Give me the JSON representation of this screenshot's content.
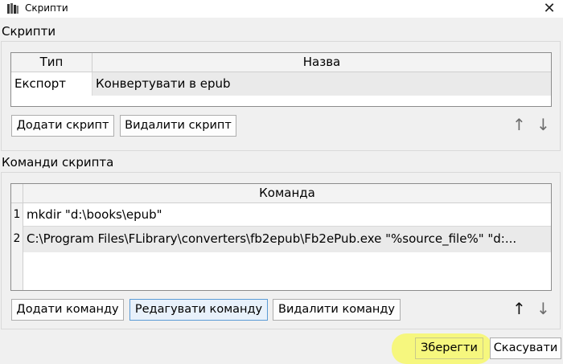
{
  "window": {
    "title": "Скрипти"
  },
  "scripts": {
    "section_label": "Скрипти",
    "columns": [
      "Тип",
      "Назва"
    ],
    "rows": [
      {
        "type": "Експорт",
        "name": "Конвертувати в epub"
      }
    ],
    "add_button": "Додати скрипт",
    "delete_button": "Видалити скрипт"
  },
  "commands": {
    "section_label": "Команди скрипта",
    "column": "Команда",
    "rows": [
      {
        "index": "1",
        "command": "mkdir \"d:\\books\\epub\""
      },
      {
        "index": "2",
        "command": "C:\\Program Files\\FLibrary\\converters\\fb2epub\\Fb2ePub.exe \"%source_file%\" \"d:..."
      }
    ],
    "add_button": "Додати команду",
    "edit_button": "Редагувати команду",
    "delete_button": "Видалити команду"
  },
  "footer": {
    "save_button": "Зберегти",
    "cancel_button": "Скасувати"
  },
  "icons": {
    "up": "arrow-up-icon",
    "down": "arrow-down-icon",
    "close": "close-icon",
    "app": "books-icon"
  },
  "colors": {
    "highlight": "#f7f86a",
    "focus_border": "#5b9bd5"
  }
}
